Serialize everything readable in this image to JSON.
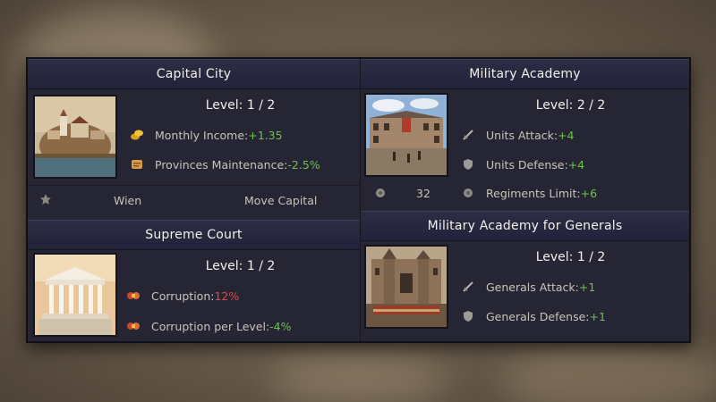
{
  "capital": {
    "title": "Capital City",
    "level": "Level: 1 / 2",
    "stats": [
      {
        "label": "Monthly Income: ",
        "value": "+1.35",
        "icon": "coins-icon",
        "tone": "pos"
      },
      {
        "label": "Provinces Maintenance: ",
        "value": "-2.5%",
        "icon": "scroll-icon",
        "tone": "pos"
      }
    ],
    "city_name": "Wien",
    "move_label": "Move Capital"
  },
  "court": {
    "title": "Supreme Court",
    "level": "Level: 1 / 2",
    "stats": [
      {
        "label": "Corruption: ",
        "value": "12%",
        "icon": "corruption-icon",
        "tone": "neg"
      },
      {
        "label": "Corruption per Level: ",
        "value": "-4%",
        "icon": "corruption-icon",
        "tone": "pos"
      }
    ]
  },
  "academy": {
    "title": "Military Academy",
    "level": "Level: 2 / 2",
    "stats": [
      {
        "label": "Units Attack: ",
        "value": "+4",
        "icon": "sword-icon",
        "tone": "pos"
      },
      {
        "label": "Units Defense: ",
        "value": "+4",
        "icon": "shield-icon",
        "tone": "pos"
      },
      {
        "label": "Regiments Limit: ",
        "value": "+6",
        "icon": "regiment-icon",
        "tone": "pos"
      }
    ],
    "regiment_count": "32"
  },
  "generals": {
    "title": "Military Academy for Generals",
    "level": "Level: 1 / 2",
    "stats": [
      {
        "label": "Generals Attack: ",
        "value": "+1",
        "icon": "sword-icon",
        "tone": "pos"
      },
      {
        "label": "Generals Defense: ",
        "value": "+1",
        "icon": "shield-icon",
        "tone": "pos"
      }
    ]
  },
  "colors": {
    "positive": "#6cc24a",
    "negative": "#e0473c",
    "header": "#2c2d44"
  }
}
